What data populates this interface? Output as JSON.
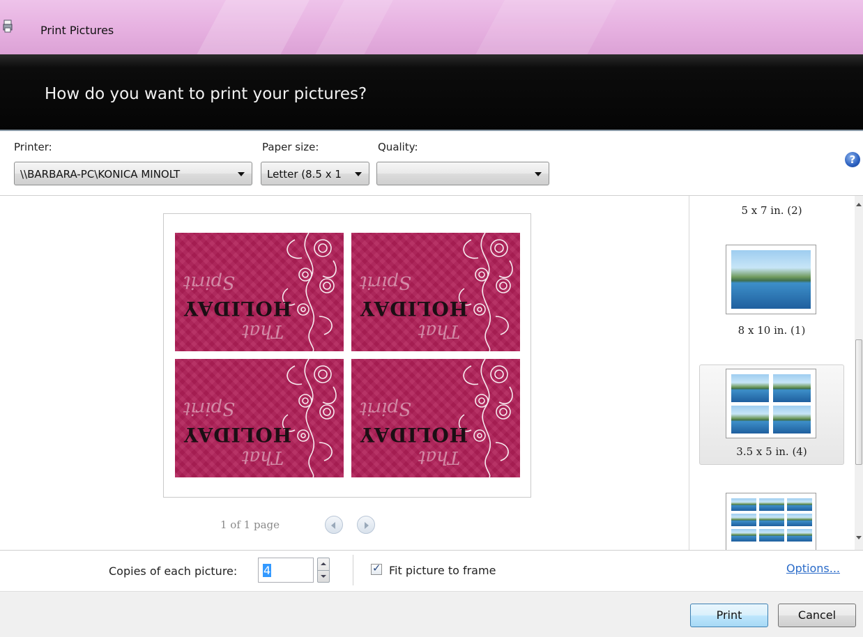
{
  "window": {
    "title": "Print Pictures"
  },
  "header": {
    "question": "How do you want to print your pictures?"
  },
  "settings": {
    "printer_label": "Printer:",
    "printer_value": "\\\\BARBARA-PC\\KONICA MINOLT",
    "paper_label": "Paper size:",
    "paper_value": "Letter (8.5 x 1",
    "quality_label": "Quality:",
    "quality_value": ""
  },
  "preview": {
    "pager": "1 of 1 page",
    "card_text": {
      "main": "HOLIDAY",
      "spirit": "Spirit",
      "that": "That"
    }
  },
  "layouts": [
    {
      "label": "5 x 7 in. (2)"
    },
    {
      "label": "8 x 10 in. (1)"
    },
    {
      "label": "3.5 x 5 in. (4)",
      "selected": true
    },
    {
      "label": ""
    }
  ],
  "bottom": {
    "copies_label": "Copies of each picture:",
    "copies_value": "4",
    "fit_label": "Fit picture to frame",
    "fit_checked": true,
    "options_link": "Options..."
  },
  "buttons": {
    "print": "Print",
    "cancel": "Cancel"
  },
  "colors": {
    "titlebar": "#e6b0e0",
    "header": "#050505",
    "card": "#b01f57",
    "link": "#2a6bc9"
  }
}
